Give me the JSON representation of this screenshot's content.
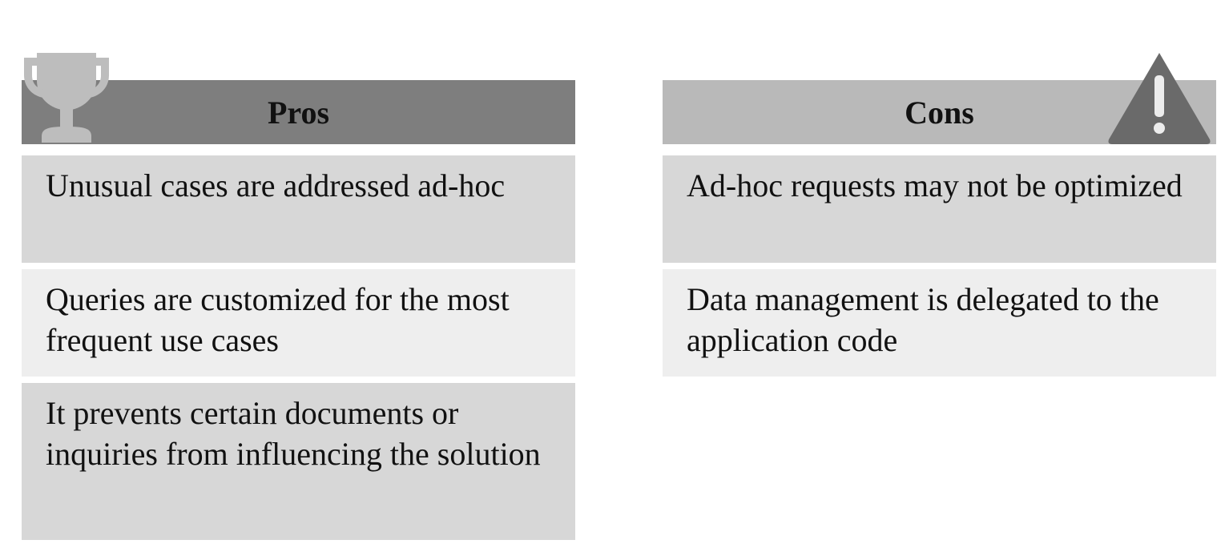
{
  "pros": {
    "header": "Pros",
    "icon": "trophy-icon",
    "header_color": "#7e7e7e",
    "items": [
      "Unusual cases are addressed ad-hoc",
      "Queries are customized for the most frequent use cases",
      "It prevents certain documents or inquiries from influencing the solution"
    ]
  },
  "cons": {
    "header": "Cons",
    "icon": "warning-icon",
    "header_color": "#b9b9b9",
    "items": [
      "Ad-hoc requests may not be optimized",
      "Data management is delegated to the application code"
    ]
  }
}
